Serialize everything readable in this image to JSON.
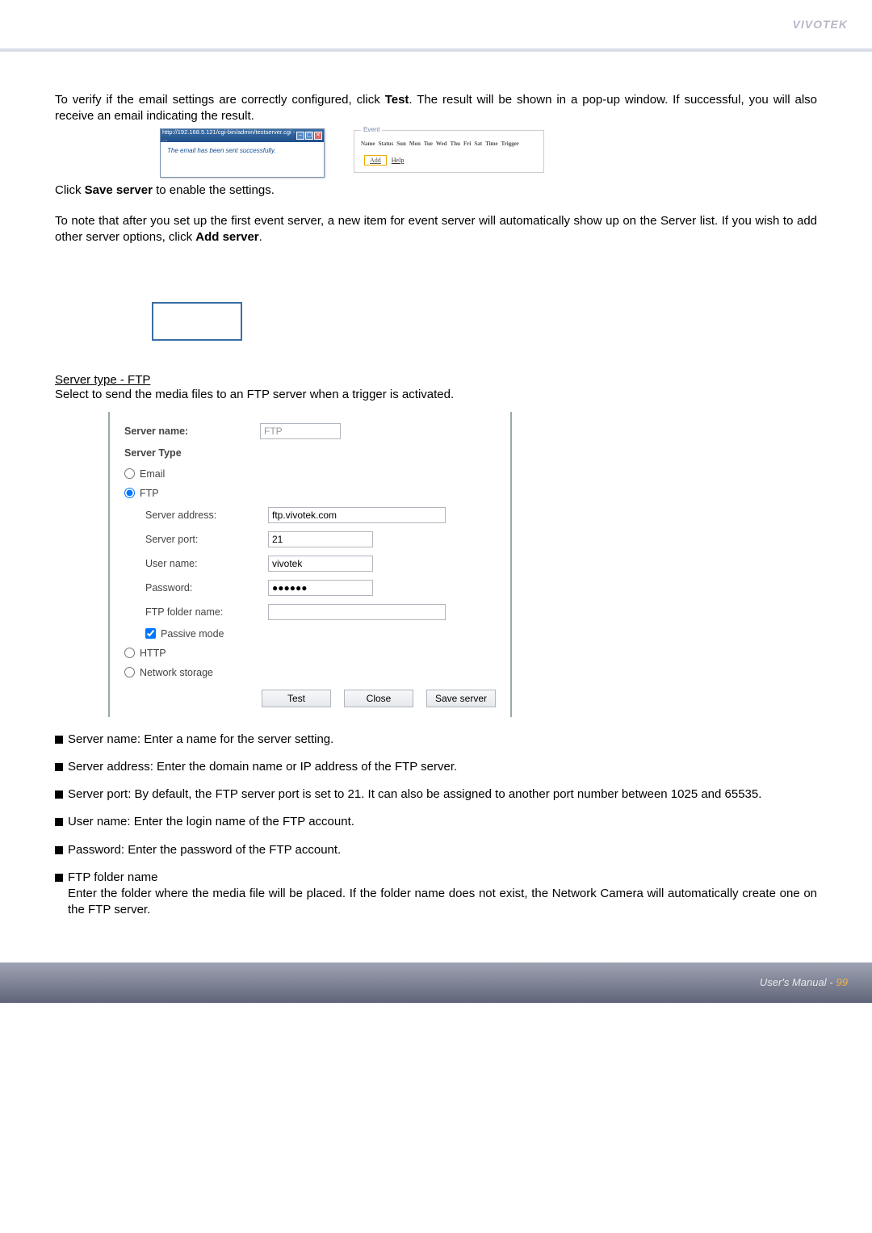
{
  "brand": "VIVOTEK",
  "p1": "To verify if the email settings are correctly configured, click ",
  "p1_strong": "Test",
  "p1_after": ". The result will be shown in a pop-up window. If successful, you will also receive an email indicating the result.",
  "popup": {
    "title": "http://192.168.5.121/cgi-bin/admin/testserver.cgi - ...",
    "body": "The email has been sent successfully."
  },
  "event": {
    "legend": "Event",
    "cols": [
      "Name",
      "Status",
      "Sun",
      "Mon",
      "Tue",
      "Wed",
      "Thu",
      "Fri",
      "Sat",
      "Time",
      "Trigger"
    ],
    "add_btn": "Add",
    "help_link": "Help"
  },
  "p2_pre": "Click ",
  "p2_strong": "Save server",
  "p2_post": " to enable the settings.",
  "p3_pre": "To note that after you set up the first event server, a new item for event server will automatically show up on the Server list.  If you wish to add other server options, click ",
  "p3_strong": "Add server",
  "p3_post": ".",
  "stype_heading": "Server type - FTP",
  "stype_desc": "Select to send the media files to an FTP server when a trigger is activated.",
  "form": {
    "server_name_label": "Server name:",
    "server_name_value": "FTP",
    "group_heading": "Server Type",
    "email_label": "Email",
    "ftp_label": "FTP",
    "server_address_label": "Server address:",
    "server_address_value": "ftp.vivotek.com",
    "server_port_label": "Server port:",
    "server_port_value": "21",
    "user_name_label": "User name:",
    "user_name_value": "vivotek",
    "password_label": "Password:",
    "password_value": "●●●●●●",
    "ftp_folder_label": "FTP folder name:",
    "ftp_folder_value": "",
    "passive_label": "Passive mode",
    "http_label": "HTTP",
    "netstorage_label": "Network storage",
    "btn_test": "Test",
    "btn_close": "Close",
    "btn_save": "Save server"
  },
  "bullets": {
    "b1": "Server name: Enter a name for the server setting.",
    "b2": "Server address: Enter the domain name or IP address of the FTP server.",
    "b3": "Server port: By default, the FTP server port is set to 21. It can also be assigned to another port number between 1025 and 65535.",
    "b4": "User name: Enter the login name of the FTP account.",
    "b5": "Password: Enter the password of the FTP account.",
    "b6_head": "FTP folder name",
    "b6_body": "Enter the folder where the media file will be placed. If the folder name does not exist, the Network Camera will automatically create one on the FTP server."
  },
  "footer": {
    "label": "User's Manual - ",
    "page": "99"
  }
}
